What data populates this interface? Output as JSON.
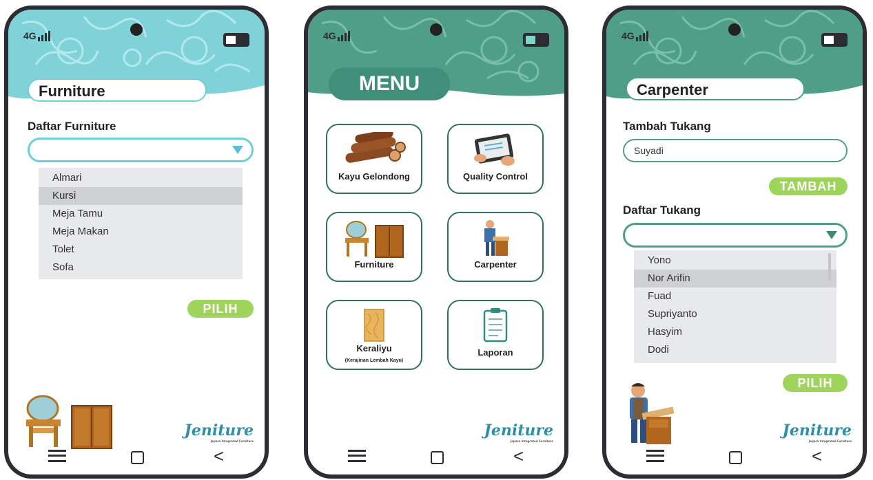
{
  "status": {
    "network": "4G"
  },
  "colors": {
    "accent_light": "#6dcfd6",
    "accent_dark": "#3f8f7b",
    "button_green": "#9ed45a",
    "list_bg": "#e8e9ec"
  },
  "screens": {
    "furniture": {
      "title": "Furniture",
      "list_label": "Daftar Furniture",
      "dropdown_value": "",
      "options": [
        "Almari",
        "Kursi",
        "Meja Tamu",
        "Meja Makan",
        "Tolet",
        "Sofa"
      ],
      "selected_option": "Kursi",
      "pick_button": "PILIH"
    },
    "menu": {
      "title": "MENU",
      "items": [
        {
          "label": "Kayu Gelondong",
          "sublabel": "",
          "icon": "logs-icon"
        },
        {
          "label": "Quality Control",
          "sublabel": "",
          "icon": "tablet-checklist-icon"
        },
        {
          "label": "Furniture",
          "sublabel": "",
          "icon": "furniture-icon"
        },
        {
          "label": "Carpenter",
          "sublabel": "",
          "icon": "carpenter-icon"
        },
        {
          "label": "Keraliyu",
          "sublabel": "(Kerajinan Lembah Kayu)",
          "icon": "wood-block-icon"
        },
        {
          "label": "Laporan",
          "sublabel": "",
          "icon": "clipboard-icon"
        }
      ]
    },
    "carpenter": {
      "title": "Carpenter",
      "add_label": "Tambah Tukang",
      "add_value": "Suyadi",
      "add_button": "TAMBAH",
      "list_label": "Daftar Tukang",
      "dropdown_value": "",
      "options": [
        "Yono",
        "Nor Arifin",
        "Fuad",
        "Supriyanto",
        "Hasyim",
        "Dodi"
      ],
      "selected_option": "Nor Arifin",
      "pick_button": "PILIH"
    }
  },
  "brand": {
    "logo": "Jeniture",
    "tagline": "Jepara Integrated Furniture"
  },
  "nav": {
    "back": "<"
  }
}
